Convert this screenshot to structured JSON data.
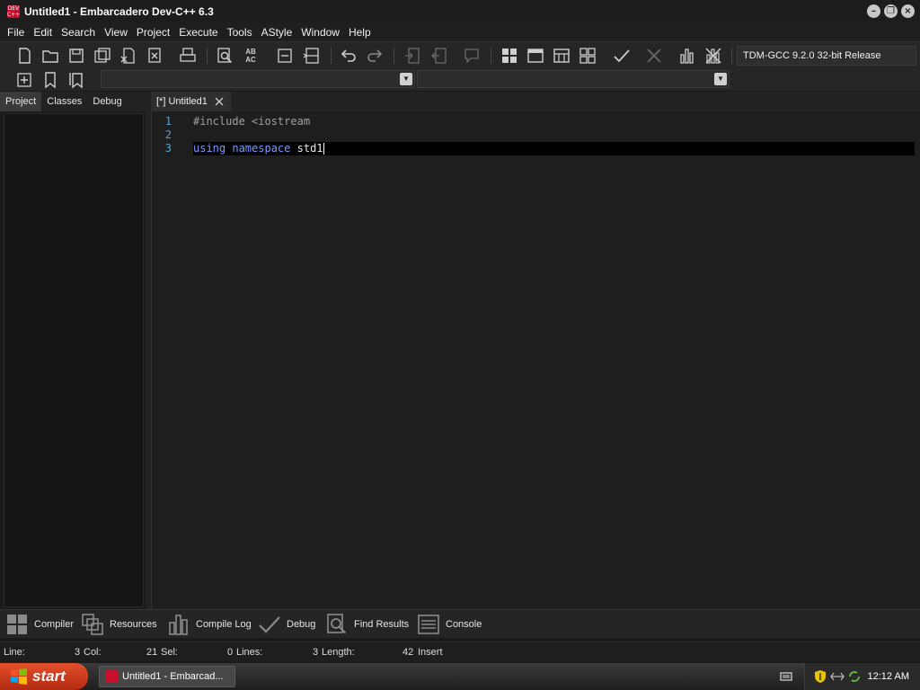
{
  "window": {
    "title": "Untitled1 - Embarcadero Dev-C++ 6.3",
    "app_icon_text": "DEV C++"
  },
  "menu": [
    "File",
    "Edit",
    "Search",
    "View",
    "Project",
    "Execute",
    "Tools",
    "AStyle",
    "Window",
    "Help"
  ],
  "toolbar": {
    "compiler": "TDM-GCC 9.2.0 32-bit Release",
    "replace_icon_text": "AB AC"
  },
  "left_tabs": [
    "Project",
    "Classes",
    "Debug"
  ],
  "editor": {
    "tab_label": "[*] Untitled1",
    "line_numbers": [
      "1",
      "2",
      "3"
    ],
    "lines": {
      "l1_pre": "#include <iostream",
      "l3_kw1": "using",
      "l3_kw2": "namespace",
      "l3_rest": "std1"
    }
  },
  "output_tabs": [
    "Compiler",
    "Resources",
    "Compile Log",
    "Debug",
    "Find Results",
    "Console"
  ],
  "status": {
    "line_label": "Line:",
    "line_value": "3",
    "col_label": "Col:",
    "col_value": "21",
    "sel_label": "Sel:",
    "sel_value": "0",
    "lines_label": "Lines:",
    "lines_value": "3",
    "length_label": "Length:",
    "length_value": "42",
    "mode": "Insert"
  },
  "taskbar": {
    "start": "start",
    "app_label": "Untitled1 - Embarcad...",
    "clock": "12:12 AM"
  },
  "colors": {
    "background": "#1e1e1e",
    "line_number": "#4fa3d9",
    "keyword": "#7a9cff",
    "current_line": "#000000"
  }
}
